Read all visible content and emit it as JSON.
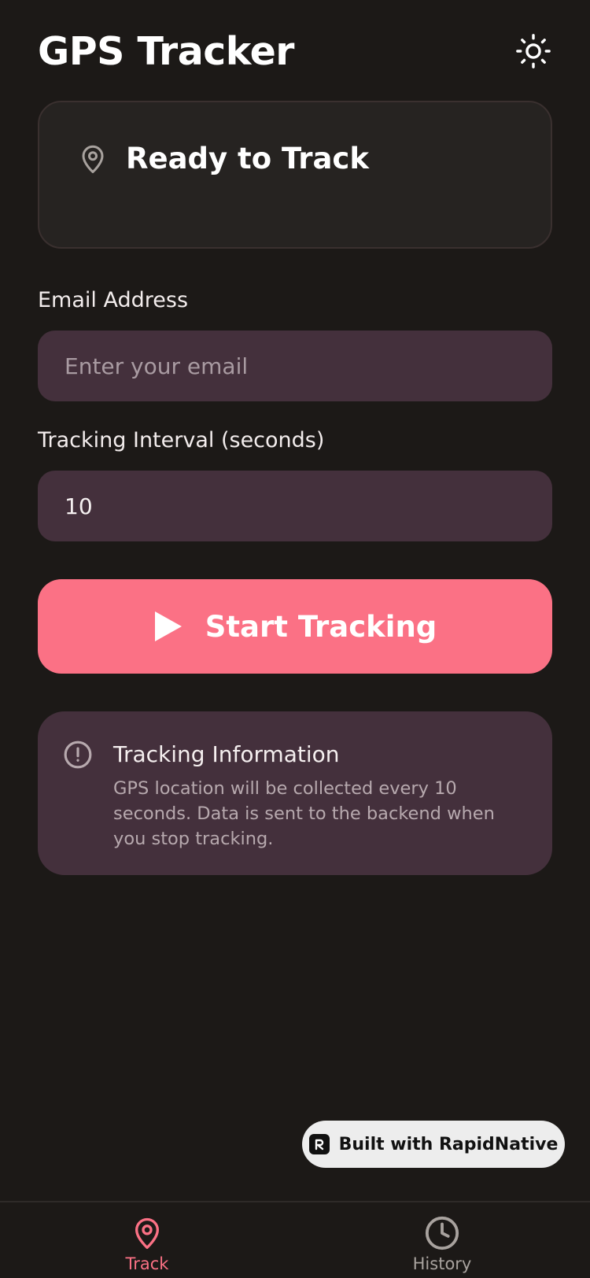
{
  "header": {
    "title": "GPS Tracker",
    "theme_icon": "sun-icon"
  },
  "status": {
    "icon": "map-pin-icon",
    "text": "Ready to Track"
  },
  "form": {
    "email": {
      "label": "Email Address",
      "value": "",
      "placeholder": "Enter your email"
    },
    "interval": {
      "label": "Tracking Interval (seconds)",
      "value": "10",
      "placeholder": ""
    }
  },
  "start_button": {
    "icon": "play-icon",
    "label": "Start Tracking"
  },
  "info": {
    "icon": "alert-circle-icon",
    "title": "Tracking Information",
    "body": "GPS location will be collected every 10 seconds. Data is sent to the backend when you stop tracking."
  },
  "badge": {
    "label": "Built with RapidNative"
  },
  "tabs": [
    {
      "label": "Track",
      "icon": "map-pin-icon",
      "active": true
    },
    {
      "label": "History",
      "icon": "clock-icon",
      "active": false
    }
  ],
  "colors": {
    "background": "#1c1917",
    "accent": "#fb7185",
    "card": "#44303c",
    "inactive": "#a8a29e"
  }
}
